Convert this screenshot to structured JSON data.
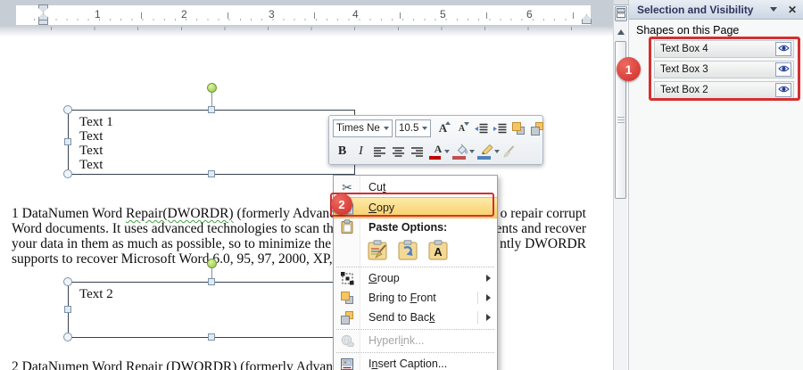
{
  "ruler": {
    "numbers": [
      "1",
      "2",
      "3",
      "4",
      "5",
      "6"
    ]
  },
  "textboxes": {
    "box1_lines": [
      "Text 1",
      "Text",
      "Text",
      "Text"
    ],
    "box2_line": "Text 2"
  },
  "paragraph": {
    "l1_pre": "1 DataNumen Word ",
    "l1_wavy": "Repair(DWORDR)",
    "l1_post": " (formerly Advanced W",
    "l1_right": "o repair corrupt",
    "l2_left": "Word documents. It uses advanced technologies to scan the co",
    "l2_right": "ents and recover",
    "l3_left": "your data in them as much as possible, so to minimize the",
    "l3_right": "ntly DWORDR",
    "l4_left": "supports to recover Microsoft Word 6.0, 95, 97, 2000, XP, 200",
    "bottom_partial": "2 DataNumen Word Repair (DWORDR) (formerly Advanced W"
  },
  "minibar": {
    "font_name": "Times Ne",
    "font_size": "10.5",
    "bold": "B",
    "italic": "I",
    "font_color_letter": "A",
    "grow_letter": "A",
    "shrink_letter": "A"
  },
  "menu": {
    "cut": {
      "pre": "Cu",
      "key": "t",
      "post": ""
    },
    "copy": {
      "pre": "",
      "key": "C",
      "post": "opy"
    },
    "paste_label": "Paste Options:",
    "group": {
      "pre": "",
      "key": "G",
      "post": "roup"
    },
    "bring": {
      "pre": "Bring to ",
      "key": "F",
      "post": "ront"
    },
    "send": {
      "pre": "Send to Bac",
      "key": "k",
      "post": ""
    },
    "hyperlink": {
      "pre": "Hyperl",
      "key": "i",
      "post": "nk..."
    },
    "caption": {
      "pre": "I",
      "key": "n",
      "post": "sert Caption..."
    },
    "paste_text_only_letter": "A"
  },
  "panel": {
    "title": "Selection and Visibility",
    "subtitle": "Shapes on this Page",
    "items": [
      {
        "label": "Text Box 4"
      },
      {
        "label": "Text Box 3"
      },
      {
        "label": "Text Box 2"
      }
    ],
    "close_glyph": "✕"
  },
  "annotations": {
    "step1": "1",
    "step2": "2"
  },
  "colors": {
    "annotation_red": "#d43030",
    "copy_highlight": "#f8cf67",
    "rotate_handle_green": "#8cc63e"
  }
}
